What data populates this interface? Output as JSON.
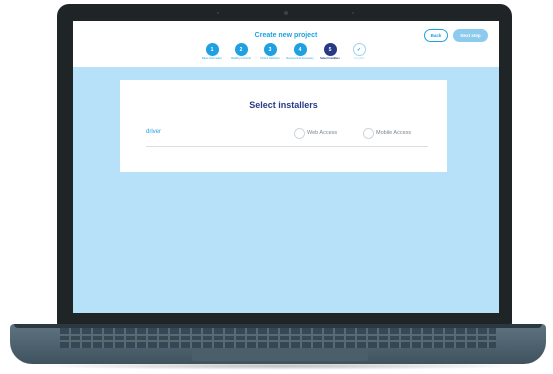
{
  "header": {
    "title": "Create new project",
    "back_label": "Back",
    "next_label": "Next step"
  },
  "steps": [
    {
      "number": "1",
      "label": "Basic Information",
      "state": "complete"
    },
    {
      "number": "2",
      "label": "Building Controls",
      "state": "complete"
    },
    {
      "number": "3",
      "label": "Fixture Selection",
      "state": "complete"
    },
    {
      "number": "4",
      "label": "Recommend Accessory",
      "state": "complete"
    },
    {
      "number": "5",
      "label": "Select Installers",
      "state": "active"
    },
    {
      "number": "✓",
      "label": "Complete",
      "state": "pending"
    }
  ],
  "card": {
    "title": "Select installers",
    "row_label": "driver",
    "options": [
      {
        "label": "Web Access",
        "selected": false
      },
      {
        "label": "Mobile Access",
        "selected": false
      }
    ]
  },
  "colors": {
    "primary": "#1fa0e0",
    "navy": "#283a86",
    "screen_bg": "#b7e1f8"
  }
}
